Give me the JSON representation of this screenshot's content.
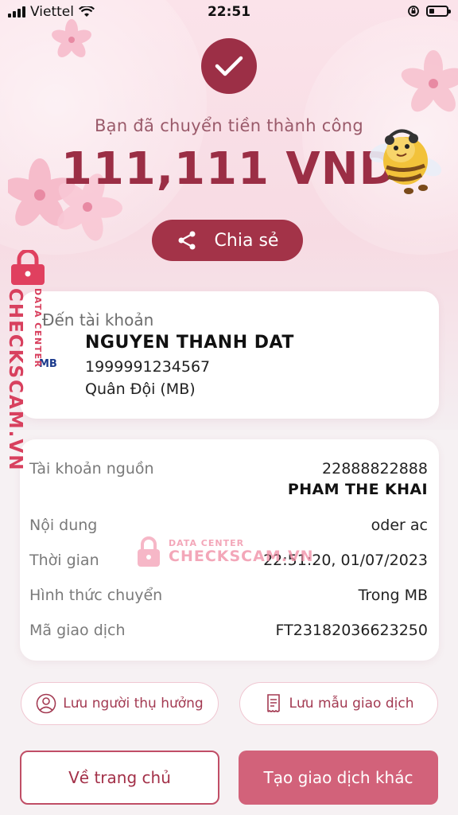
{
  "status_bar": {
    "carrier": "Viettel",
    "time": "22:51"
  },
  "result": {
    "success_message": "Bạn đã chuyển tiền thành công",
    "amount": "111,111 VND",
    "share_label": "Chia sẻ"
  },
  "recipient": {
    "label": "Đến tài khoản",
    "bank_logo": "MB",
    "name": "NGUYEN THANH DAT",
    "account_number": "1999991234567",
    "bank_name": "Quân Đội (MB)"
  },
  "details": [
    {
      "label": "Tài khoản nguồn",
      "value": "22888822888",
      "value2": "PHAM THE KHAI"
    },
    {
      "label": "Nội dung",
      "value": "oder ac"
    },
    {
      "label": "Thời gian",
      "value": "22:51:20, 01/07/2023"
    },
    {
      "label": "Hình thức chuyển",
      "value": "Trong MB"
    },
    {
      "label": "Mã giao dịch",
      "value": "FT23182036623250"
    }
  ],
  "actions": {
    "save_recipient": "Lưu người thụ hưởng",
    "save_template": "Lưu mẫu giao dịch",
    "home": "Về trang chủ",
    "new_transaction": "Tạo giao dịch khác"
  },
  "watermark": {
    "side_big": "CHECKSCAM.VN",
    "side_small": "DATA CENTER",
    "center_small": "DATA CENTER",
    "center_big": "CHECKSCAM.VN"
  },
  "colors": {
    "primary": "#9c2f46",
    "accent": "#d2627a",
    "watermark": "#d8405e"
  },
  "icons": [
    "check-icon",
    "share-icon",
    "user-circle-icon",
    "receipt-icon",
    "lock-icon",
    "wifi-icon",
    "signal-icon",
    "battery-icon",
    "rotation-lock-icon"
  ]
}
